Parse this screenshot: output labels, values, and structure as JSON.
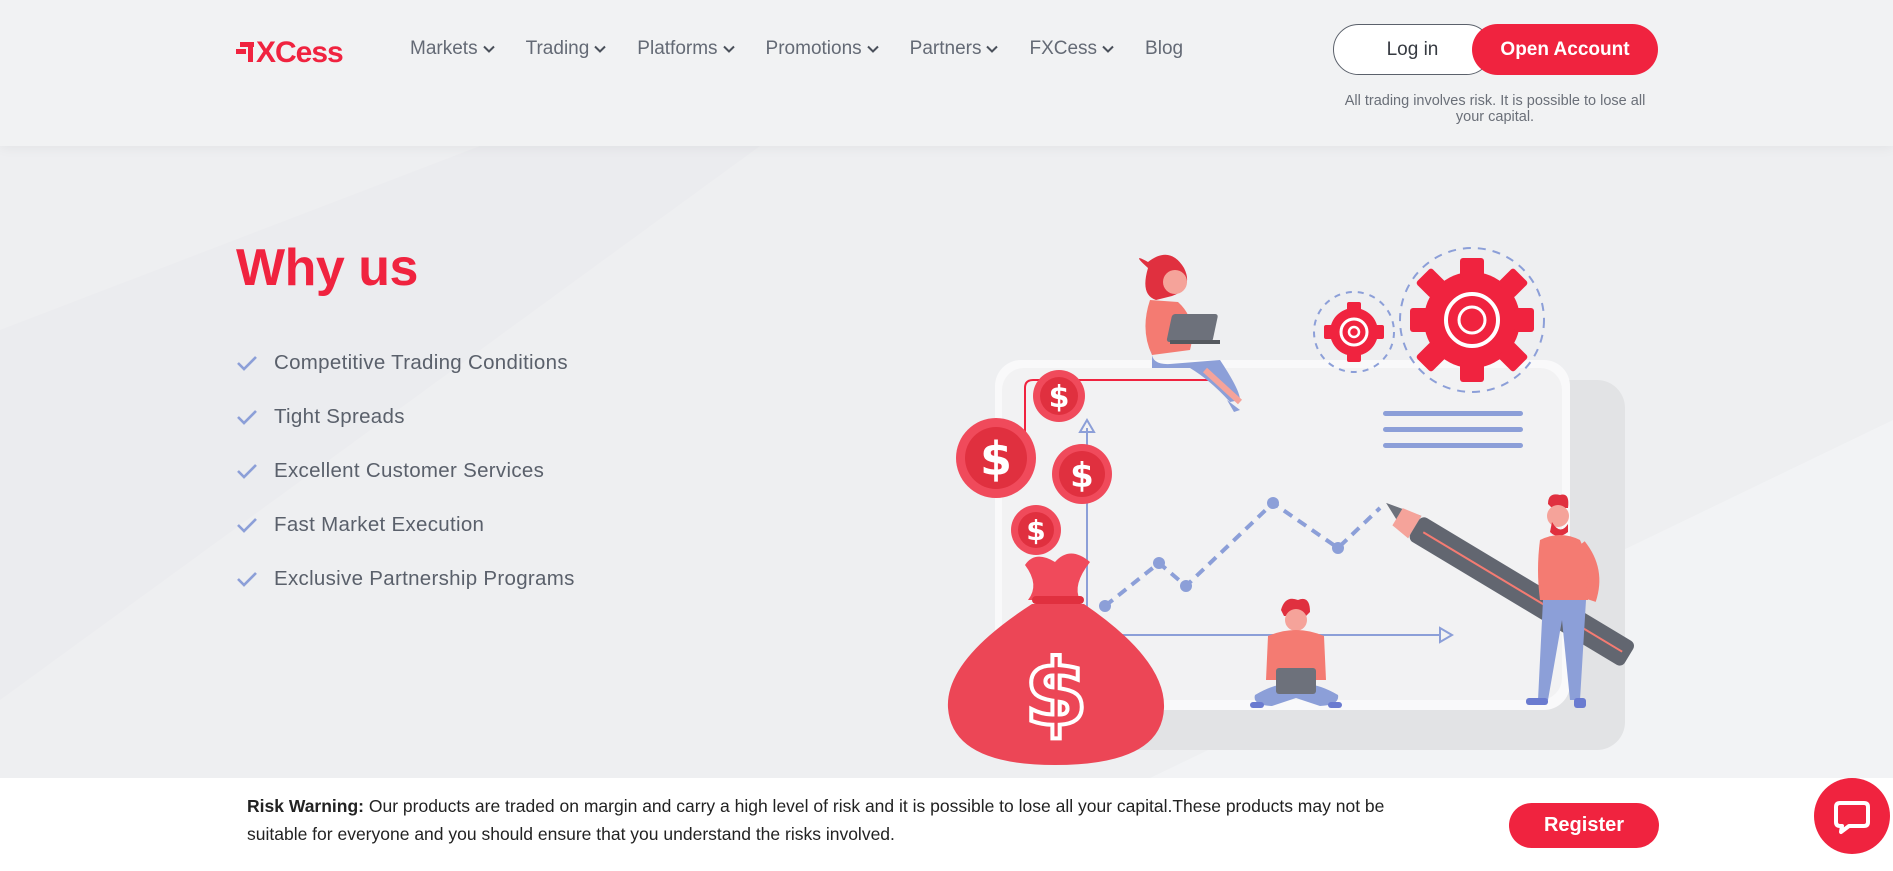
{
  "header": {
    "nav": [
      {
        "label": "Markets"
      },
      {
        "label": "Trading"
      },
      {
        "label": "Platforms"
      },
      {
        "label": "Promotions"
      },
      {
        "label": "Partners"
      },
      {
        "label": "FXCess"
      },
      {
        "label": "Blog"
      }
    ],
    "login_label": "Log in",
    "open_account_label": "Open Account",
    "risk_note": "All trading involves risk. It is possible to lose all your capital."
  },
  "main": {
    "title": "Why us",
    "features": [
      "Competitive Trading Conditions",
      "Tight Spreads",
      "Excellent Customer Services",
      "Fast Market Execution",
      "Exclusive Partnership Programs"
    ]
  },
  "footer": {
    "risk_label": "Risk Warning:",
    "risk_text": " Our products are traded on margin and carry a high level of risk and it is possible to lose all your capital.These products may not be suitable for everyone and you should ensure that you understand the risks involved.",
    "register_label": "Register"
  },
  "colors": {
    "brand": "#f0233f",
    "accent": "#8c9fd8"
  },
  "icons": [
    "fxcess-logo",
    "chevron-down-icon",
    "check-icon",
    "chat-icon"
  ]
}
